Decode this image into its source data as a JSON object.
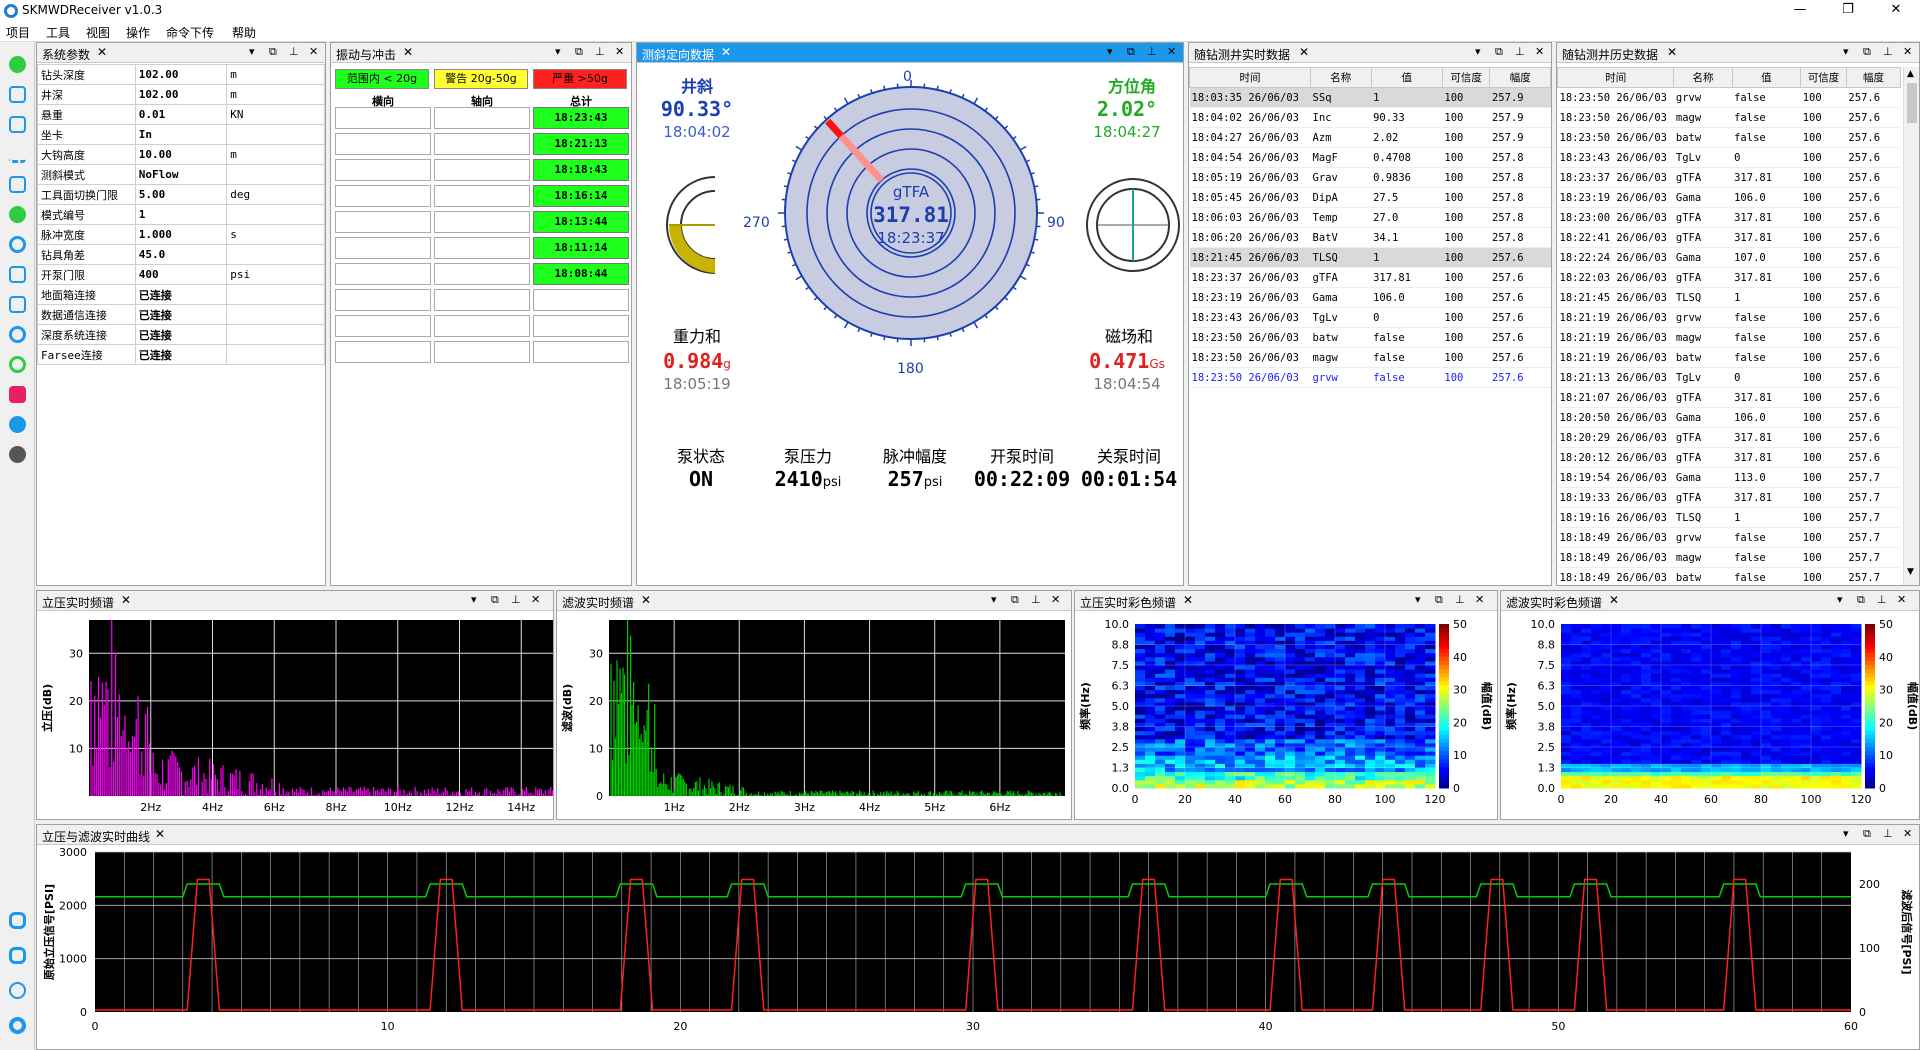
{
  "app": {
    "title": "SKMWDReceiver v1.0.3"
  },
  "menu": [
    "项目",
    "工具",
    "视图",
    "操作",
    "命令下传",
    "帮助"
  ],
  "sys": {
    "title": "系统参数",
    "rows": [
      [
        "钻头深度",
        "102.00",
        "m"
      ],
      [
        "井深",
        "102.00",
        "m"
      ],
      [
        "悬重",
        "0.01",
        "KN"
      ],
      [
        "坐卡",
        "In",
        ""
      ],
      [
        "大钩高度",
        "10.00",
        "m"
      ],
      [
        "测斜模式",
        "NoFlow",
        ""
      ],
      [
        "工具面切换门限",
        "5.00",
        "deg"
      ],
      [
        "模式编号",
        "1",
        ""
      ],
      [
        "脉冲宽度",
        "1.000",
        "s"
      ],
      [
        "钻具角差",
        "45.0",
        ""
      ],
      [
        "开泵门限",
        "400",
        "psi"
      ],
      [
        "地面箱连接",
        "已连接",
        ""
      ],
      [
        "数据通信连接",
        "已连接",
        ""
      ],
      [
        "深度系统连接",
        "已连接",
        ""
      ],
      [
        "Farsee连接",
        "已连接",
        ""
      ]
    ]
  },
  "vib": {
    "title": "振动与冲击",
    "tag_ok": "范围内 < 20g",
    "tag_warn": "警告 20g-50g",
    "tag_err": "严重 >50g",
    "col_h": "横向",
    "col_a": "轴向",
    "col_t": "总计",
    "times": [
      "18:23:43",
      "18:21:13",
      "18:18:43",
      "18:16:14",
      "18:13:44",
      "18:11:14",
      "18:08:44"
    ]
  },
  "survey": {
    "title": "测斜定向数据",
    "inc_label": "井斜",
    "inc": "90.33°",
    "inc_time": "18:04:02",
    "azm_label": "方位角",
    "azm": "2.02°",
    "azm_time": "18:04:27",
    "grav_label": "重力和",
    "grav": "0.984",
    "grav_unit": "g",
    "grav_time": "18:05:19",
    "mag_label": "磁场和",
    "mag": "0.471",
    "mag_unit": "Gs",
    "mag_time": "18:04:54",
    "tf_label": "gTFA",
    "tf": "317.81",
    "tf_time": "18:23:37",
    "tf_angle": 317.81,
    "dial": {
      "n": "0",
      "e": "90",
      "s": "180",
      "w": "270"
    },
    "pump": [
      {
        "label": "泵状态",
        "value": "ON",
        "unit": ""
      },
      {
        "label": "泵压力",
        "value": "2410",
        "unit": "psi"
      },
      {
        "label": "脉冲幅度",
        "value": "257",
        "unit": "psi"
      },
      {
        "label": "开泵时间",
        "value": "00:22:09",
        "unit": ""
      },
      {
        "label": "关泵时间",
        "value": "00:01:54",
        "unit": ""
      }
    ]
  },
  "rt": {
    "title": "随钻测井实时数据",
    "cols": [
      "时间",
      "名称",
      "值",
      "可信度",
      "幅度"
    ],
    "rows": [
      [
        "18:03:35 26/06/03",
        "SSq",
        "1",
        "100",
        "257.9"
      ],
      [
        "18:04:02 26/06/03",
        "Inc",
        "90.33",
        "100",
        "257.9"
      ],
      [
        "18:04:27 26/06/03",
        "Azm",
        "2.02",
        "100",
        "257.9"
      ],
      [
        "18:04:54 26/06/03",
        "MagF",
        "0.4708",
        "100",
        "257.8"
      ],
      [
        "18:05:19 26/06/03",
        "Grav",
        "0.9836",
        "100",
        "257.8"
      ],
      [
        "18:05:45 26/06/03",
        "DipA",
        "27.5",
        "100",
        "257.8"
      ],
      [
        "18:06:03 26/06/03",
        "Temp",
        "27.0",
        "100",
        "257.8"
      ],
      [
        "18:06:20 26/06/03",
        "BatV",
        "34.1",
        "100",
        "257.8"
      ],
      [
        "18:21:45 26/06/03",
        "TLSQ",
        "1",
        "100",
        "257.6"
      ],
      [
        "18:23:37 26/06/03",
        "gTFA",
        "317.81",
        "100",
        "257.6"
      ],
      [
        "18:23:19 26/06/03",
        "Gama",
        "106.0",
        "100",
        "257.6"
      ],
      [
        "18:23:43 26/06/03",
        "TgLv",
        "0",
        "100",
        "257.6"
      ],
      [
        "18:23:50 26/06/03",
        "batw",
        "false",
        "100",
        "257.6"
      ],
      [
        "18:23:50 26/06/03",
        "magw",
        "false",
        "100",
        "257.6"
      ],
      [
        "18:23:50 26/06/03",
        "grvw",
        "false",
        "100",
        "257.6"
      ]
    ]
  },
  "hist": {
    "title": "随钻测井历史数据",
    "cols": [
      "时间",
      "名称",
      "值",
      "可信度",
      "幅度"
    ],
    "rows": [
      [
        "18:23:50 26/06/03",
        "grvw",
        "false",
        "100",
        "257.6"
      ],
      [
        "18:23:50 26/06/03",
        "magw",
        "false",
        "100",
        "257.6"
      ],
      [
        "18:23:50 26/06/03",
        "batw",
        "false",
        "100",
        "257.6"
      ],
      [
        "18:23:43 26/06/03",
        "TgLv",
        "0",
        "100",
        "257.6"
      ],
      [
        "18:23:37 26/06/03",
        "gTFA",
        "317.81",
        "100",
        "257.6"
      ],
      [
        "18:23:19 26/06/03",
        "Gama",
        "106.0",
        "100",
        "257.6"
      ],
      [
        "18:23:00 26/06/03",
        "gTFA",
        "317.81",
        "100",
        "257.6"
      ],
      [
        "18:22:41 26/06/03",
        "gTFA",
        "317.81",
        "100",
        "257.6"
      ],
      [
        "18:22:24 26/06/03",
        "Gama",
        "107.0",
        "100",
        "257.6"
      ],
      [
        "18:22:03 26/06/03",
        "gTFA",
        "317.81",
        "100",
        "257.6"
      ],
      [
        "18:21:45 26/06/03",
        "TLSQ",
        "1",
        "100",
        "257.6"
      ],
      [
        "18:21:19 26/06/03",
        "grvw",
        "false",
        "100",
        "257.6"
      ],
      [
        "18:21:19 26/06/03",
        "magw",
        "false",
        "100",
        "257.6"
      ],
      [
        "18:21:19 26/06/03",
        "batw",
        "false",
        "100",
        "257.6"
      ],
      [
        "18:21:13 26/06/03",
        "TgLv",
        "0",
        "100",
        "257.6"
      ],
      [
        "18:21:07 26/06/03",
        "gTFA",
        "317.81",
        "100",
        "257.6"
      ],
      [
        "18:20:50 26/06/03",
        "Gama",
        "106.0",
        "100",
        "257.6"
      ],
      [
        "18:20:29 26/06/03",
        "gTFA",
        "317.81",
        "100",
        "257.6"
      ],
      [
        "18:20:12 26/06/03",
        "gTFA",
        "317.81",
        "100",
        "257.6"
      ],
      [
        "18:19:54 26/06/03",
        "Gama",
        "113.0",
        "100",
        "257.7"
      ],
      [
        "18:19:33 26/06/03",
        "gTFA",
        "317.81",
        "100",
        "257.7"
      ],
      [
        "18:19:16 26/06/03",
        "TLSQ",
        "1",
        "100",
        "257.7"
      ],
      [
        "18:18:49 26/06/03",
        "grvw",
        "false",
        "100",
        "257.7"
      ],
      [
        "18:18:49 26/06/03",
        "magw",
        "false",
        "100",
        "257.7"
      ],
      [
        "18:18:49 26/06/03",
        "batw",
        "false",
        "100",
        "257.7"
      ]
    ]
  },
  "spec1": {
    "title": "立压实时频谱",
    "ylabel": "立压(dB)",
    "yticks": [
      "30",
      "20",
      "10"
    ],
    "xticks": [
      "2Hz",
      "4Hz",
      "6Hz",
      "8Hz",
      "10Hz",
      "12Hz",
      "14Hz"
    ],
    "color": "#ff00ff"
  },
  "spec2": {
    "title": "滤波实时频谱",
    "ylabel": "滤波(dB)",
    "yticks": [
      "30",
      "20",
      "10",
      "0"
    ],
    "xticks": [
      "1Hz",
      "2Hz",
      "3Hz",
      "4Hz",
      "5Hz",
      "6Hz"
    ],
    "color": "#00cc00"
  },
  "hm1": {
    "title": "立压实时彩色频谱",
    "ylabel": "频率(Hz)",
    "cblabel": "幅值(dB)",
    "yticks": [
      "10.0",
      "8.8",
      "7.5",
      "6.3",
      "5.0",
      "3.8",
      "2.5",
      "1.3",
      "0.0"
    ],
    "xticks": [
      "0",
      "20",
      "40",
      "60",
      "80",
      "100",
      "120"
    ],
    "cbticks": [
      "50",
      "40",
      "30",
      "20",
      "10",
      "0"
    ]
  },
  "hm2": {
    "title": "滤波实时彩色频谱",
    "ylabel": "频率(Hz)",
    "cblabel": "幅值(dB)",
    "yticks": [
      "10.0",
      "8.8",
      "7.5",
      "6.3",
      "5.0",
      "3.8",
      "2.5",
      "1.3",
      "0.0"
    ],
    "xticks": [
      "0",
      "20",
      "40",
      "60",
      "80",
      "100",
      "120"
    ],
    "cbticks": [
      "50",
      "40",
      "30",
      "20",
      "10",
      "0"
    ]
  },
  "curve": {
    "title": "立压与滤波实时曲线",
    "ylabel_left": "原始立压信号[PSI]",
    "ylabel_right": "滤波后信号[PSI]",
    "yticks_left": [
      "3000",
      "2000",
      "1000",
      "0"
    ],
    "yticks_right": [
      "200",
      "100",
      "0"
    ],
    "xticks": [
      "0",
      "10",
      "20",
      "30",
      "40",
      "50",
      "60"
    ],
    "pulse_x": [
      3.7,
      12,
      18.5,
      22.3,
      30.3,
      36,
      40.7,
      44.2,
      47.9,
      51.1,
      56.2
    ],
    "high": 2410,
    "low": 2410
  }
}
